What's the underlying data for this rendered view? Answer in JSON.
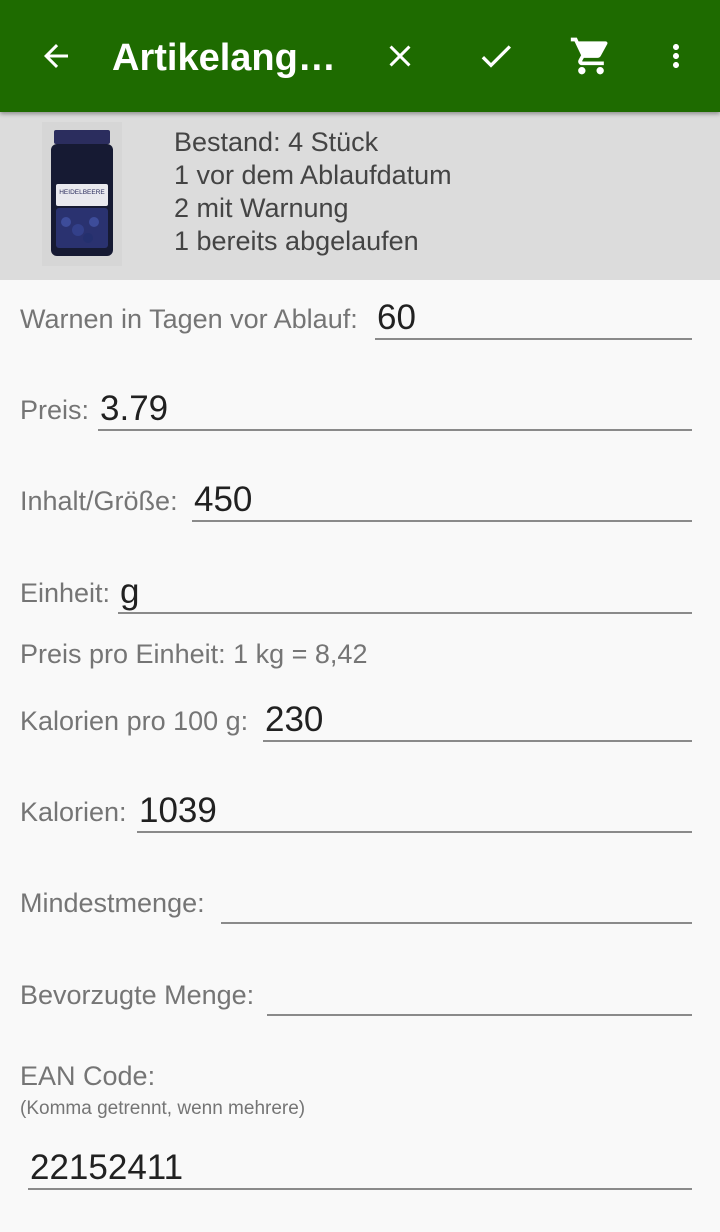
{
  "app_bar": {
    "title": "Artikelangaben",
    "back_icon": "arrow-back-icon",
    "close_icon": "close-icon",
    "confirm_icon": "check-icon",
    "cart_icon": "shopping-cart-icon",
    "more_icon": "more-vert-icon",
    "background_color": "#1e6b00"
  },
  "summary": {
    "image_label": "HEIDELBEERE",
    "stock": "Bestand: 4 Stück",
    "before_expiry": "1 vor dem Ablaufdatum",
    "with_warning": "2 mit Warnung",
    "expired": "1 bereits abgelaufen"
  },
  "form": {
    "warn_days": {
      "label": "Warnen in Tagen vor Ablauf:",
      "value": "60"
    },
    "price": {
      "label": "Preis:",
      "value": "3.79"
    },
    "size": {
      "label": "Inhalt/Größe:",
      "value": "450"
    },
    "unit": {
      "label": "Einheit:",
      "value": "g"
    },
    "price_per_unit": "Preis pro Einheit: 1 kg = 8,42",
    "calories_per_100": {
      "label": "Kalorien pro 100 g:",
      "value": "230"
    },
    "calories": {
      "label": "Kalorien:",
      "value": "1039"
    },
    "min_quantity": {
      "label": "Mindestmenge:",
      "value": ""
    },
    "preferred_quantity": {
      "label": "Bevorzugte Menge:",
      "value": ""
    },
    "ean": {
      "label": "EAN Code:",
      "hint": "(Komma getrennt, wenn mehrere)",
      "value": "22152411"
    }
  }
}
